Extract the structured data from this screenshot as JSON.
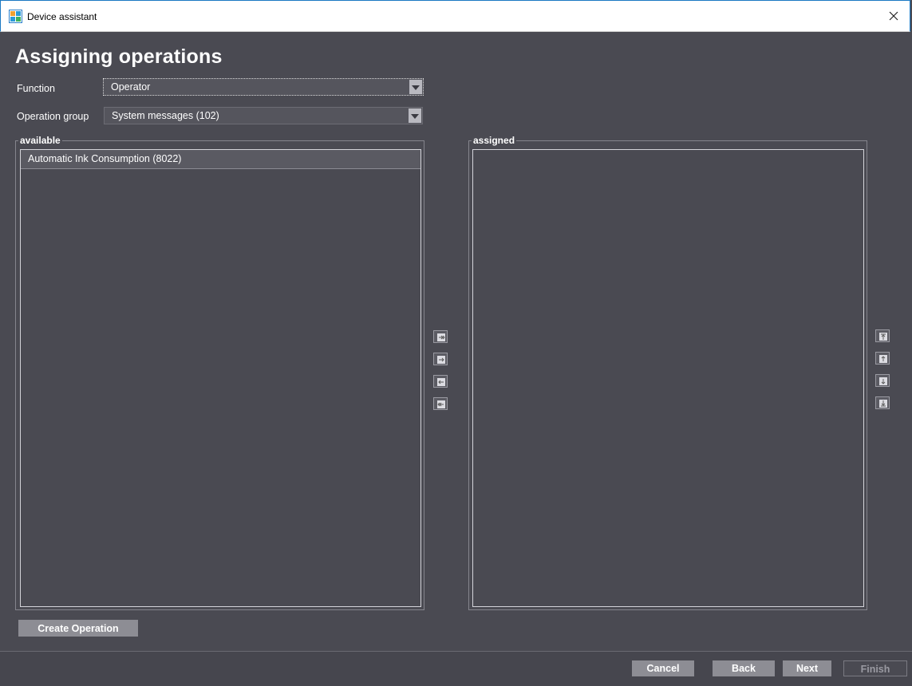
{
  "window": {
    "title": "Device assistant",
    "icon": "device-assistant-icon",
    "close_icon": "close-icon"
  },
  "page": {
    "heading": "Assigning operations"
  },
  "form": {
    "function_label": "Function",
    "function_value": "Operator",
    "group_label": "Operation group",
    "group_value": "System messages (102)"
  },
  "available": {
    "title": "available",
    "items": [
      "Automatic Ink Consumption (8022)"
    ]
  },
  "assigned": {
    "title": "assigned",
    "items": []
  },
  "transfer_buttons": [
    "move-all-right-icon",
    "move-right-icon",
    "move-left-icon",
    "move-all-left-icon"
  ],
  "order_buttons": [
    "move-top-icon",
    "move-up-icon",
    "move-down-icon",
    "move-bottom-icon"
  ],
  "actions": {
    "create_operation": "Create Operation"
  },
  "footer": {
    "cancel": "Cancel",
    "back": "Back",
    "next": "Next",
    "finish": "Finish"
  },
  "colors": {
    "background": "#4a4a52",
    "button": "#8d8d94",
    "window_border": "#1a78c2"
  }
}
